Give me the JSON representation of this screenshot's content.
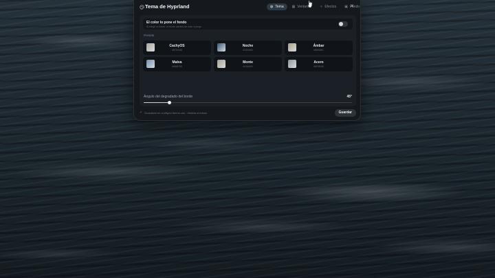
{
  "window": {
    "title": "Tema de Hyprland",
    "close_icon": "✕"
  },
  "tabs": [
    {
      "label": "Tema",
      "icon": "palette-icon",
      "active": true
    },
    {
      "label": "Ventanas",
      "icon": "windows-icon",
      "active": false
    },
    {
      "label": "Efectos",
      "icon": "sparkle-icon",
      "active": false
    },
    {
      "label": "Fondo",
      "icon": "image-icon",
      "active": false
    }
  ],
  "background_color": {
    "title": "El color lo pone el fondo",
    "subtitle": "Al elegir un fondo, el borde cambia de color a juego",
    "enabled": false
  },
  "presets": {
    "label": "Presets",
    "items": [
      {
        "name": "CachyOS",
        "hex": "#B7B3A8",
        "color": "#a9a69b"
      },
      {
        "name": "Noche",
        "hex": "#3A5A80",
        "color": "#3b5676"
      },
      {
        "name": "Ámbar",
        "hex": "#B8A88C",
        "color": "#a89f88"
      },
      {
        "name": "Malva",
        "hex": "#6B8FB5",
        "color": "#6f8fb1"
      },
      {
        "name": "Monte",
        "hex": "#A9A590",
        "color": "#a3a08f"
      },
      {
        "name": "Acero",
        "hex": "#8E9BA5",
        "color": "#8b969e"
      }
    ]
  },
  "gradient": {
    "label": "Ángulo del degradado del borde",
    "value_text": "45°",
    "fraction": 0.125
  },
  "footer": {
    "text": "Guardado en config/ui-theme.css · reinicia al iniciar",
    "save_label": "Guardar"
  }
}
